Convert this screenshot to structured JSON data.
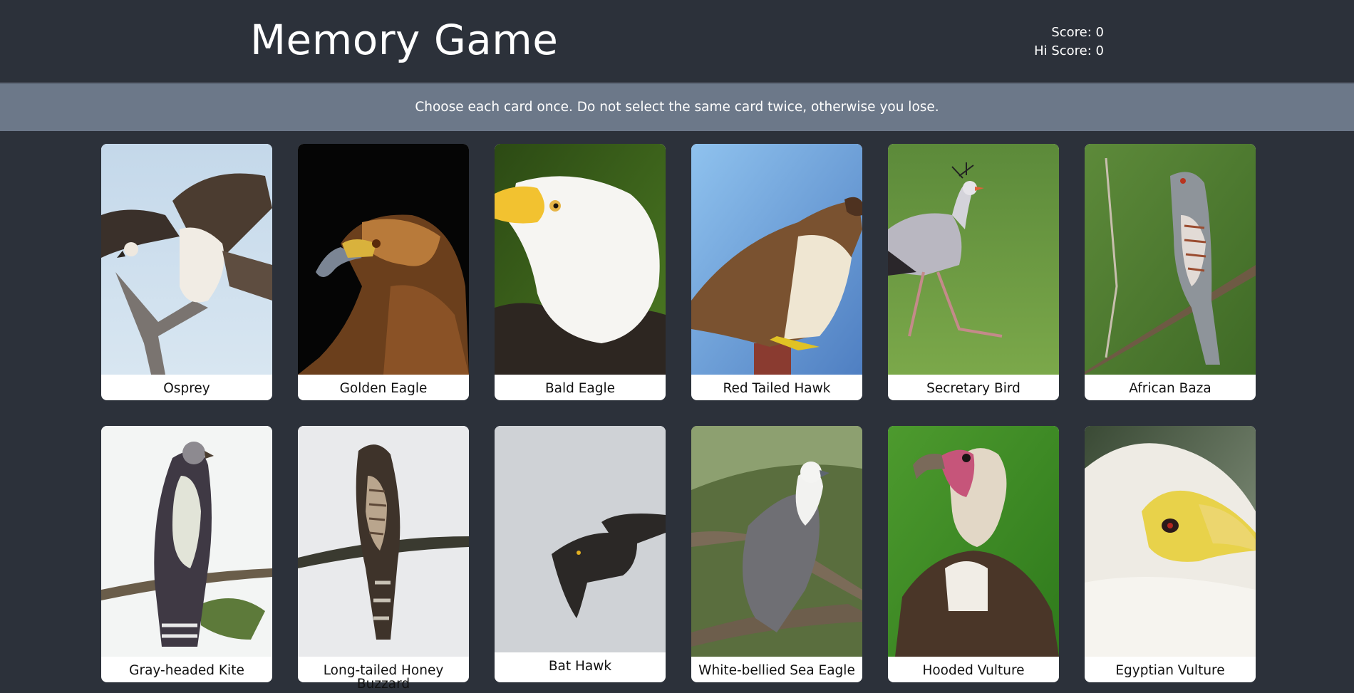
{
  "header": {
    "title": "Memory Game",
    "score_label": "Score: 0",
    "hiscore_label": "Hi Score: 0"
  },
  "banner": {
    "instructions": "Choose each card once. Do not select the same card twice, otherwise you lose."
  },
  "cards": [
    {
      "name": "Osprey",
      "icon": "osprey-photo"
    },
    {
      "name": "Golden Eagle",
      "icon": "golden-eagle-photo"
    },
    {
      "name": "Bald Eagle",
      "icon": "bald-eagle-photo"
    },
    {
      "name": "Red Tailed Hawk",
      "icon": "red-tailed-hawk-photo"
    },
    {
      "name": "Secretary Bird",
      "icon": "secretary-bird-photo"
    },
    {
      "name": "African Baza",
      "icon": "african-baza-photo"
    },
    {
      "name": "Gray-headed Kite",
      "icon": "gray-headed-kite-photo"
    },
    {
      "name": "Long-tailed Honey Buzzard",
      "icon": "long-tailed-honey-buzzard-photo"
    },
    {
      "name": "Bat Hawk",
      "icon": "bat-hawk-photo"
    },
    {
      "name": "White-bellied Sea Eagle",
      "icon": "white-bellied-sea-eagle-photo"
    },
    {
      "name": "Hooded Vulture",
      "icon": "hooded-vulture-photo"
    },
    {
      "name": "Egyptian Vulture",
      "icon": "egyptian-vulture-photo"
    }
  ],
  "colors": {
    "background": "#2c313a",
    "banner": "#6c7889",
    "card": "#ffffff"
  }
}
